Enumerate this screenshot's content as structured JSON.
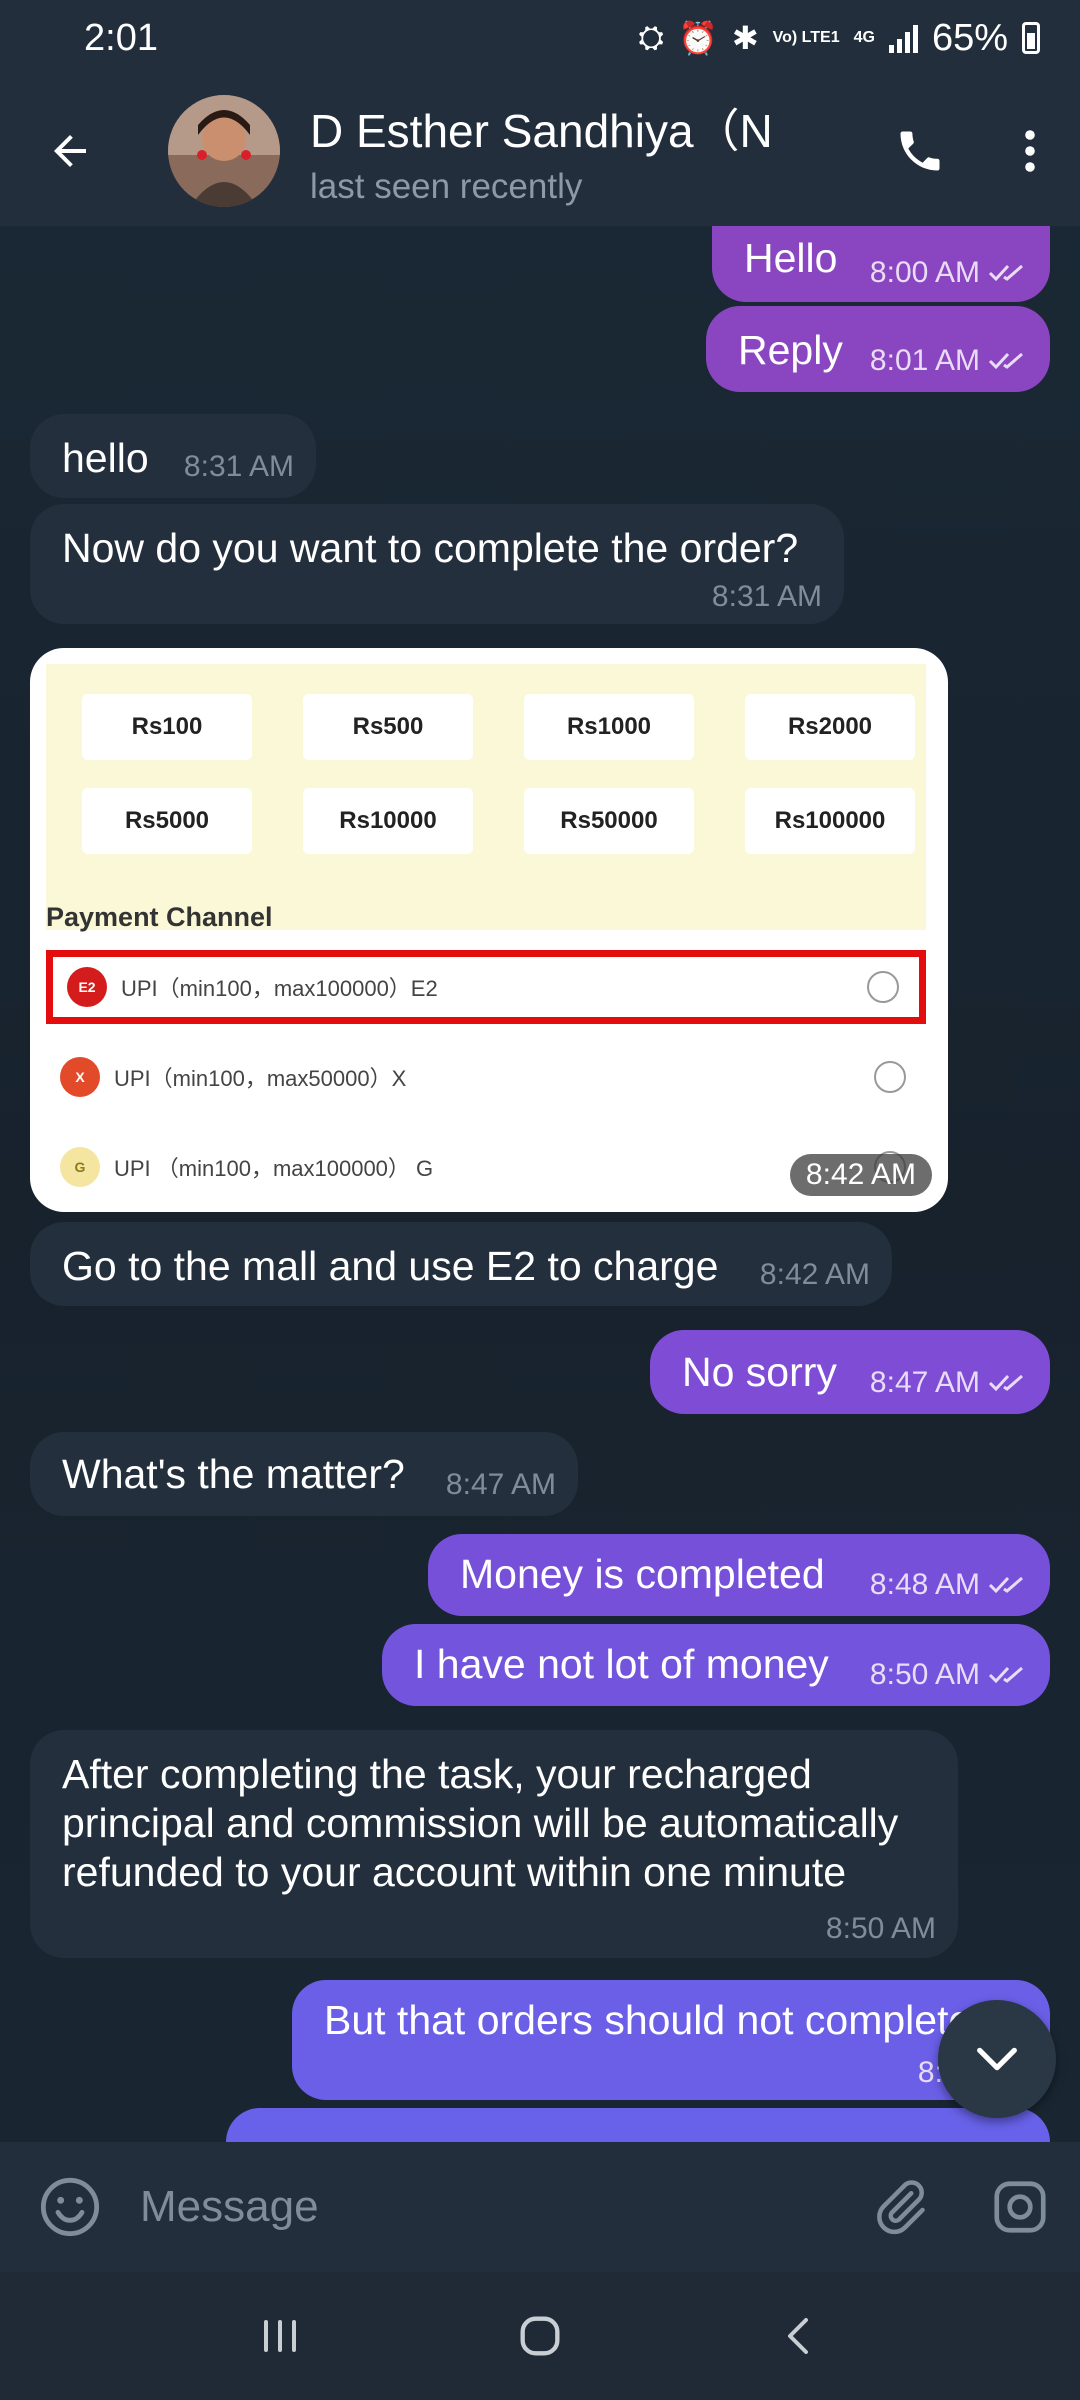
{
  "status_bar": {
    "time": "2:01",
    "network_top": "Vo) LTE1",
    "network_type": "4G",
    "battery": "65%"
  },
  "header": {
    "name": "D Esther Sandhiya（N",
    "status": "last seen recently"
  },
  "messages": [
    {
      "dir": "out",
      "text": "Hello",
      "time": "8:00 AM",
      "read": true
    },
    {
      "dir": "out",
      "text": "Reply",
      "time": "8:01 AM",
      "read": true
    },
    {
      "dir": "in",
      "text": "hello",
      "time": "8:31 AM"
    },
    {
      "dir": "in",
      "text": "Now do you want to complete the order?",
      "time": "8:31 AM"
    },
    {
      "dir": "in",
      "text": "Go to the mall and use E2 to charge",
      "time": "8:42 AM"
    },
    {
      "dir": "out",
      "text": "No sorry",
      "time": "8:47 AM",
      "read": true
    },
    {
      "dir": "in",
      "text": "What's the matter?",
      "time": "8:47 AM"
    },
    {
      "dir": "out",
      "text": "Money is completed",
      "time": "8:48 AM",
      "read": true
    },
    {
      "dir": "out",
      "text": "I have not lot of money",
      "time": "8:50 AM",
      "read": true
    },
    {
      "dir": "in",
      "text": "After completing the task, your recharged principal and commission will be automatically refunded to your account within one minute",
      "time": "8:50 AM"
    },
    {
      "dir": "out",
      "text": "But that orders should not complete d",
      "time": "8:51 AM",
      "read": true
    }
  ],
  "image_message": {
    "time": "8:42 AM",
    "amounts": [
      "Rs100",
      "Rs500",
      "Rs1000",
      "Rs2000",
      "Rs5000",
      "Rs10000",
      "Rs50000",
      "Rs100000"
    ],
    "section_title": "Payment Channel",
    "channels": [
      {
        "label": "UPI（min100，max100000）E2",
        "selected_highlight": true
      },
      {
        "label": "UPI（min100，max50000）X",
        "selected_highlight": false
      },
      {
        "label": "UPI （min100，max100000） G",
        "selected_highlight": false
      }
    ]
  },
  "input": {
    "placeholder": "Message"
  },
  "colors": {
    "outgoing_bubble": "#8a46c0",
    "outgoing_bubble_late": "#6b5fe8",
    "incoming_bubble": "#232f3c",
    "header_bg": "#222e3b"
  }
}
